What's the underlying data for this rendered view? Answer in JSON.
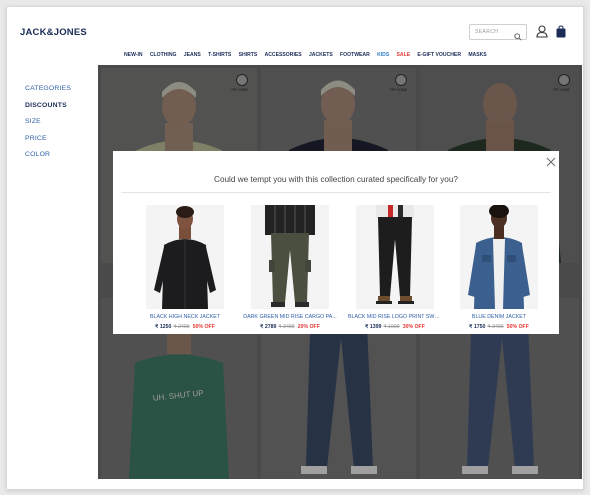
{
  "header": {
    "logo": "JACK&JONES",
    "search_placeholder": "SEARCH"
  },
  "nav": {
    "items": [
      {
        "label": "NEW-IN",
        "style": "normal"
      },
      {
        "label": "CLOTHING",
        "style": "normal"
      },
      {
        "label": "JEANS",
        "style": "normal"
      },
      {
        "label": "T-SHIRTS",
        "style": "normal"
      },
      {
        "label": "SHIRTS",
        "style": "normal"
      },
      {
        "label": "ACCESSORIES",
        "style": "normal"
      },
      {
        "label": "JACKETS",
        "style": "normal"
      },
      {
        "label": "FOOTWEAR",
        "style": "normal"
      },
      {
        "label": "KIDS",
        "style": "kids"
      },
      {
        "label": "SALE",
        "style": "sale"
      },
      {
        "label": "E-GIFT VOUCHER",
        "style": "normal"
      },
      {
        "label": "MASKS",
        "style": "normal"
      }
    ]
  },
  "filters": {
    "items": [
      {
        "label": "CATEGORIES",
        "bold": false
      },
      {
        "label": "DISCOUNTS",
        "bold": true
      },
      {
        "label": "SIZE",
        "bold": false
      },
      {
        "label": "PRICE",
        "bold": false
      },
      {
        "label": "COLOR",
        "bold": false
      }
    ]
  },
  "grid": {
    "badge_label": "TRY HOME"
  },
  "modal": {
    "title": "Could we tempt you with this collection curated specifically for you?",
    "products": [
      {
        "name": "BLACK HIGH NECK JACKET",
        "price": "₹ 1250",
        "mrp": "₹ 2499",
        "discount": "50% OFF"
      },
      {
        "name": "DARK GREEN MID RISE CARGO PA...",
        "price": "₹ 2789",
        "mrp": "₹ 3499",
        "discount": "20% OFF"
      },
      {
        "name": "BLACK MID RISE LOGO PRINT SWE...",
        "price": "₹ 1399",
        "mrp": "₹ 1999",
        "discount": "30% OFF"
      },
      {
        "name": "BLUE DENIM JACKET",
        "price": "₹ 1750",
        "mrp": "₹ 3499",
        "discount": "50% OFF"
      }
    ]
  },
  "colors": {
    "brand_navy": "#1a2c57",
    "link_blue": "#2f5fa8",
    "sale_red": "#e53935",
    "kids_blue": "#2f7ec7"
  }
}
